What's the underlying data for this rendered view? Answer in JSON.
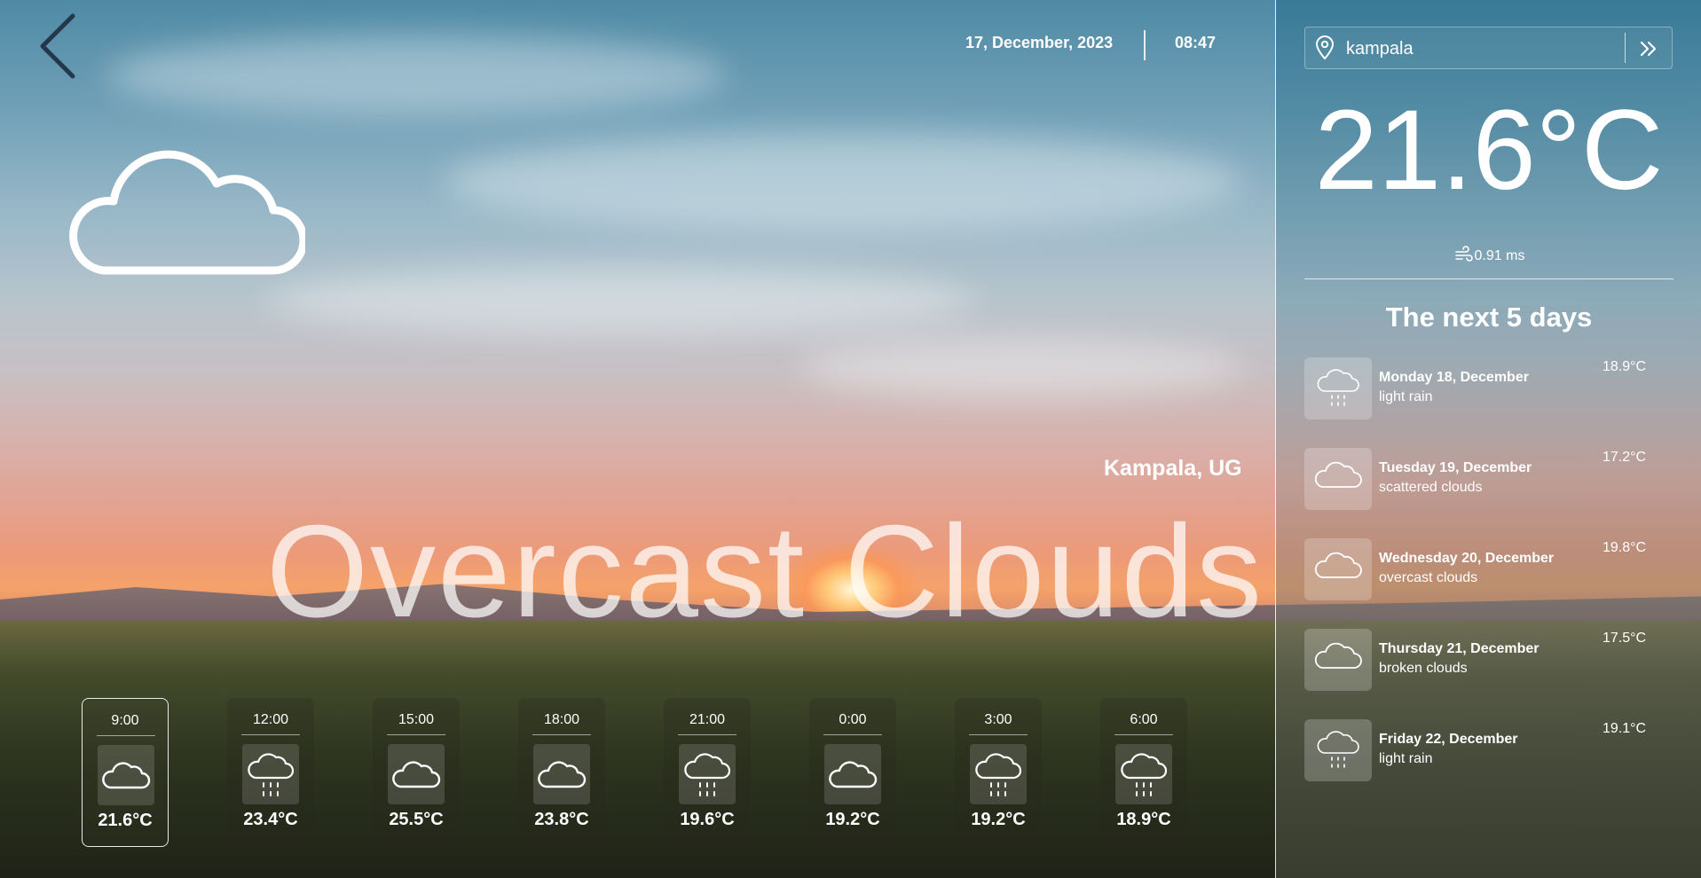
{
  "header": {
    "date": "17, December, 2023",
    "time": "08:47"
  },
  "main": {
    "location": "Kampala, UG",
    "condition": "Overcast Clouds",
    "condition_icon": "cloud-icon"
  },
  "hourly": [
    {
      "time": "9:00",
      "temp": "21.6°C",
      "icon": "cloud-icon",
      "selected": true
    },
    {
      "time": "12:00",
      "temp": "23.4°C",
      "icon": "rain-icon"
    },
    {
      "time": "15:00",
      "temp": "25.5°C",
      "icon": "cloud-icon"
    },
    {
      "time": "18:00",
      "temp": "23.8°C",
      "icon": "cloud-icon"
    },
    {
      "time": "21:00",
      "temp": "19.6°C",
      "icon": "rain-icon"
    },
    {
      "time": "0:00",
      "temp": "19.2°C",
      "icon": "cloud-icon"
    },
    {
      "time": "3:00",
      "temp": "19.2°C",
      "icon": "rain-icon"
    },
    {
      "time": "6:00",
      "temp": "18.9°C",
      "icon": "rain-icon"
    }
  ],
  "panel": {
    "search_value": "kampala",
    "current_temp": "21.6°C",
    "wind": "0.91 ms",
    "forecast_title": "The next 5 days",
    "days": [
      {
        "name": "Monday 18, December",
        "desc": "light rain",
        "temp": "18.9°C",
        "icon": "rain-icon"
      },
      {
        "name": "Tuesday 19, December",
        "desc": "scattered clouds",
        "temp": "17.2°C",
        "icon": "cloud-icon"
      },
      {
        "name": "Wednesday 20, December",
        "desc": "overcast clouds",
        "temp": "19.8°C",
        "icon": "cloud-icon"
      },
      {
        "name": "Thursday 21, December",
        "desc": "broken clouds",
        "temp": "17.5°C",
        "icon": "cloud-icon"
      },
      {
        "name": "Friday 22, December",
        "desc": "light rain",
        "temp": "19.1°C",
        "icon": "rain-icon"
      }
    ]
  },
  "colors": {
    "text": "#ffffff",
    "panel_border": "#ffffff"
  }
}
